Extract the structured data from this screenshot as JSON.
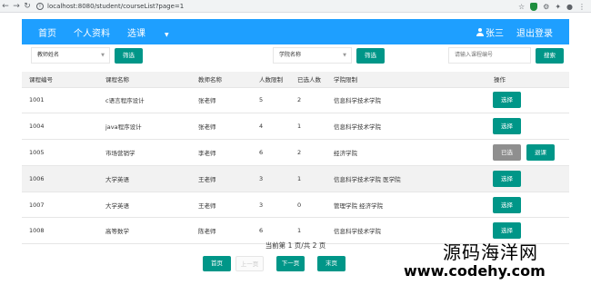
{
  "browser": {
    "back": "←",
    "forward": "→",
    "reload": "↻",
    "url": "localhost:8080/student/courseList?page=1",
    "icons": [
      "star-icon",
      "shield-icon",
      "extension-icon",
      "puzzle-icon",
      "profile-icon",
      "menu-icon"
    ]
  },
  "navbar": {
    "items": [
      "首页",
      "个人资料",
      "选课"
    ],
    "user_name": "张三",
    "logout": "退出登录"
  },
  "filters": {
    "teacher_select": "教师姓名",
    "teacher_button": "筛选",
    "college_select": "学院名称",
    "college_button": "筛选",
    "search_placeholder": "请输入课程编号",
    "search_button": "搜索"
  },
  "table": {
    "headers": [
      "课程编号",
      "课程名称",
      "教师名称",
      "人数限制",
      "已选人数",
      "学院限制",
      "操作"
    ],
    "rows": [
      {
        "id": "1001",
        "name": "c语言程序设计",
        "teacher": "张老师",
        "limit": "5",
        "selected": "2",
        "college": "信息科学技术学院",
        "actions": [
          "选择"
        ]
      },
      {
        "id": "1004",
        "name": "java程序设计",
        "teacher": "张老师",
        "limit": "4",
        "selected": "1",
        "college": "信息科学技术学院",
        "actions": [
          "选择"
        ]
      },
      {
        "id": "1005",
        "name": "市场营销学",
        "teacher": "李老师",
        "limit": "6",
        "selected": "2",
        "college": "经济学院",
        "actions": [
          "已选",
          "退课"
        ]
      },
      {
        "id": "1006",
        "name": "大学英语",
        "teacher": "王老师",
        "limit": "3",
        "selected": "1",
        "college": "信息科学技术学院 医学院",
        "actions": [
          "选择"
        ]
      },
      {
        "id": "1007",
        "name": "大学英语",
        "teacher": "王老师",
        "limit": "3",
        "selected": "0",
        "college": "管理学院 经济学院",
        "actions": [
          "选择"
        ]
      },
      {
        "id": "1008",
        "name": "高等数学",
        "teacher": "陈老师",
        "limit": "6",
        "selected": "1",
        "college": "信息科学技术学院",
        "actions": [
          "选择"
        ]
      }
    ]
  },
  "pagination": {
    "info": "当前第 1 页/共 2 页",
    "first": "首页",
    "prev": "上一页",
    "next": "下一页",
    "last": "末页"
  },
  "watermark": {
    "line1": "源码海洋网",
    "line2": "www.codehy.com"
  },
  "colors": {
    "navbar": "#1e9fff",
    "primary_button": "#009688",
    "selected_button": "#8f8f8f"
  }
}
